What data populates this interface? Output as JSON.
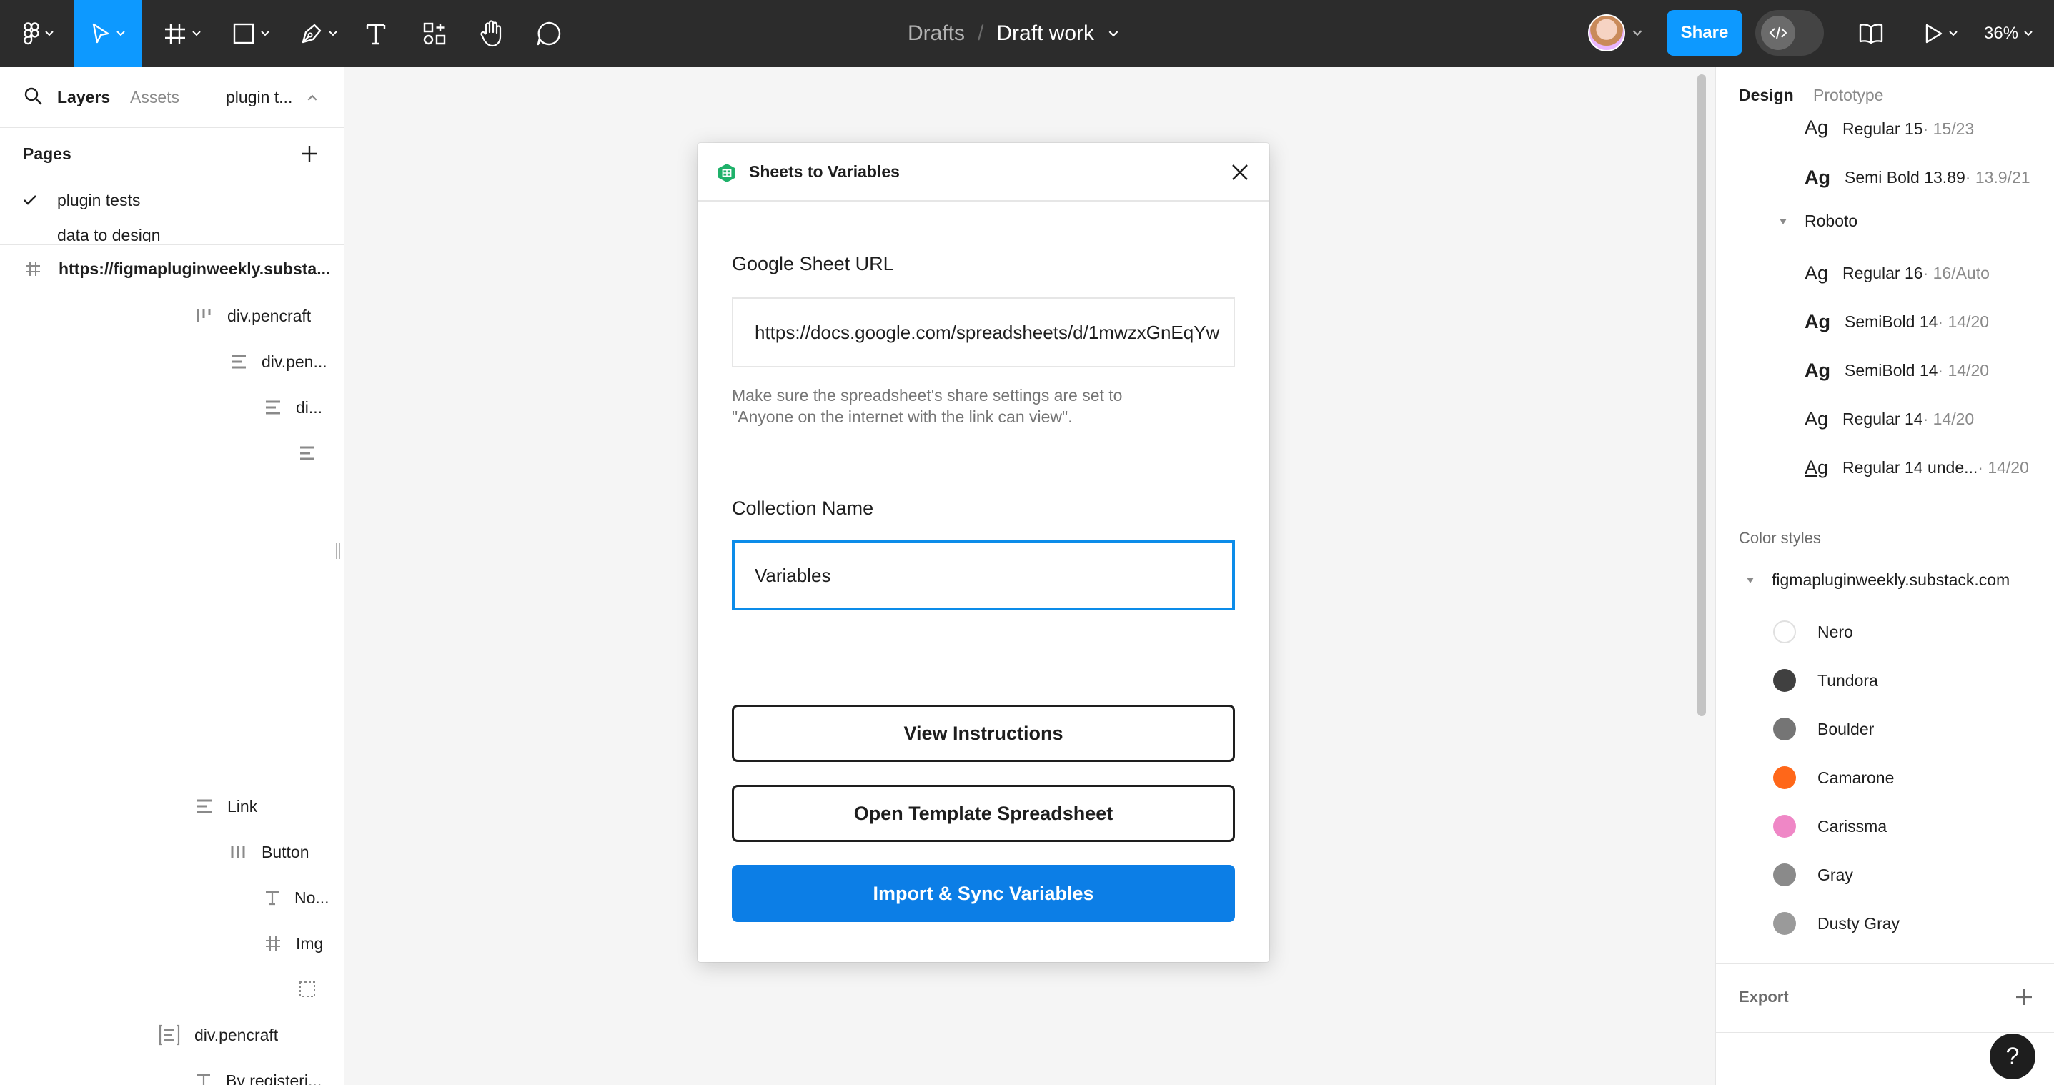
{
  "toolbar": {
    "breadcrumb_parent": "Drafts",
    "breadcrumb_separator": "/",
    "file_name": "Draft work",
    "share_label": "Share",
    "zoom_level": "36%",
    "icons": [
      "figma-menu-icon",
      "move-tool-icon",
      "frame-tool-icon",
      "shape-tool-icon",
      "pen-tool-icon",
      "text-tool-icon",
      "resources-icon",
      "hand-tool-icon",
      "comment-icon",
      "library-icon",
      "present-icon",
      "dev-mode-icon"
    ]
  },
  "left_panel": {
    "tab_layers": "Layers",
    "tab_assets": "Assets",
    "page_switch": "plugin t...",
    "pages_heading": "Pages",
    "pages": [
      {
        "label": "plugin tests",
        "current": true
      },
      {
        "label": "data to design",
        "current": false
      }
    ],
    "layers": [
      {
        "label": "https://figmapluginweekly.substa...",
        "icon": "frame-icon"
      },
      {
        "label": "div.pencraft",
        "icon": "vertical-autolayout-icon"
      },
      {
        "label": "div.pen...",
        "icon": "autolayout-icon"
      },
      {
        "label": "di...",
        "icon": "autolayout-icon"
      },
      {
        "label": "",
        "icon": "autolayout-icon"
      },
      {
        "label": "Link",
        "icon": "autolayout-icon"
      },
      {
        "label": "Button",
        "icon": "vertical-autolayout-icon"
      },
      {
        "label": "No...",
        "icon": "text-layer-icon"
      },
      {
        "label": "Img",
        "icon": "frame-icon"
      },
      {
        "label": "",
        "icon": "dashed-frame-icon"
      },
      {
        "label": "div.pencraft",
        "icon": "autolayout-wrap-icon"
      },
      {
        "label": "By registeri...",
        "icon": "text-layer-icon"
      }
    ]
  },
  "plugin": {
    "title": "Sheets to Variables",
    "sheet_url_label": "Google Sheet URL",
    "sheet_url_value": "https://docs.google.com/spreadsheets/d/1mwzxGnEqYw",
    "hint_line1": "Make sure the spreadsheet's share settings are set to",
    "hint_line2": "\"Anyone on the internet with the link can view\".",
    "collection_label": "Collection Name",
    "collection_value": "Variables",
    "view_instructions": "View Instructions",
    "open_template": "Open Template Spreadsheet",
    "import_sync": "Import & Sync Variables"
  },
  "right_panel": {
    "tab_design": "Design",
    "tab_prototype": "Prototype",
    "text_styles": [
      {
        "ag": "Ag",
        "name": "Regular 15",
        "meta": " · 15/23"
      },
      {
        "ag": "Ag",
        "name": "Semi Bold 13.89",
        "meta": " · 13.9/21"
      }
    ],
    "roboto_group": "Roboto",
    "roboto_styles": [
      {
        "ag": "Ag",
        "name": "Regular 16",
        "meta": " · 16/Auto"
      },
      {
        "ag": "Ag",
        "name": "SemiBold 14",
        "meta": " · 14/20"
      },
      {
        "ag": "Ag",
        "name": "SemiBold 14",
        "meta": " · 14/20"
      },
      {
        "ag": "Ag",
        "name": "Regular 14",
        "meta": " · 14/20"
      },
      {
        "ag": "Ag",
        "name": "Regular 14 unde...",
        "meta": " · 14/20"
      }
    ],
    "color_styles_title": "Color styles",
    "color_group": "figmapluginweekly.substack.com",
    "colors": [
      {
        "name": "Nero",
        "hex": "#ffffff"
      },
      {
        "name": "Tundora",
        "hex": "#404040"
      },
      {
        "name": "Boulder",
        "hex": "#757575"
      },
      {
        "name": "Camarone",
        "hex": "#ff6719"
      },
      {
        "name": "Carissma",
        "hex": "#ef87c6"
      },
      {
        "name": "Gray",
        "hex": "#8a8a8a"
      },
      {
        "name": "Dusty Gray",
        "hex": "#9a9a9a"
      }
    ],
    "export_label": "Export",
    "help_label": "?"
  },
  "colors": {
    "accent": "#0d99ff",
    "primary_button": "#0c7ee6",
    "toolbar_bg": "#2c2c2c",
    "plugin_icon": "#1fb16a"
  }
}
